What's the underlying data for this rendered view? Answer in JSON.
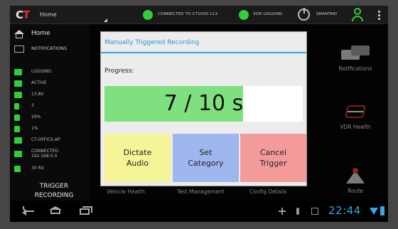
{
  "statusbar": {
    "logo_c": "C",
    "logo_t": "T",
    "home_label": "Home",
    "connection_text": "CONNECTED TO CT1000-113",
    "logging_text": "VDR LOGGING",
    "user_text": "SNANTARI",
    "status_color": "#2fcf3a"
  },
  "sidebar": {
    "home_label": "Home",
    "notifications_label": "NOTIFICATIONS",
    "status_rows": [
      {
        "icon": "logging-icon",
        "label": "LOGGING"
      },
      {
        "icon": "ignition-icon",
        "label": "ACTIVE"
      },
      {
        "icon": "battery-icon",
        "label": "13.8V"
      },
      {
        "icon": "satellite-icon",
        "label": "3"
      },
      {
        "icon": "disk-icon",
        "label": "29%"
      },
      {
        "icon": "memory-icon",
        "label": "1%"
      },
      {
        "icon": "network-icon",
        "label": "CT-OFFICE-AP"
      },
      {
        "icon": "signal-icon",
        "label": "CONNECTED",
        "sublabel": "192.168.0.0"
      },
      {
        "icon": "rx-icon",
        "label": "30 RX"
      }
    ],
    "trigger_label_1": "TRIGGER",
    "trigger_label_2": "RECORDING"
  },
  "right_panels": {
    "notifications": "Notifications",
    "vdr_health": "VDR Health",
    "route": "Route"
  },
  "bottom_labels": {
    "vehicle_health": "Vehicle Health",
    "test_management": "Test Management",
    "config_details": "Config Details"
  },
  "dialog": {
    "title": "Manually Triggered Recording",
    "progress_label": "Progress:",
    "progress_current": 7,
    "progress_total": 10,
    "progress_text": "7 / 10 s",
    "buttons": {
      "dictate_1": "Dictate",
      "dictate_2": "Audio",
      "category_1": "Set",
      "category_2": "Category",
      "cancel_1": "Cancel",
      "cancel_2": "Trigger"
    }
  },
  "navbar": {
    "time_hours": "22",
    "time_sep": ":",
    "time_minutes": "44",
    "accent_color": "#35a8e0"
  }
}
